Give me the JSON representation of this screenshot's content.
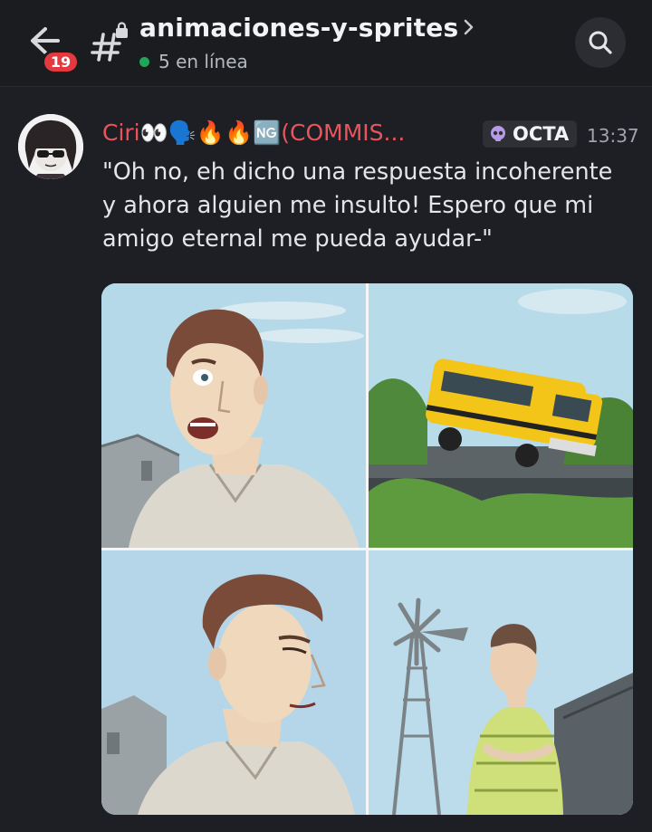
{
  "header": {
    "back_label": "back-arrow",
    "unread_badge": "19",
    "channel_name": "animaciones-y-sprites",
    "online_status": "5 en línea",
    "search_icon": "search-icon",
    "status_color": "#23a559"
  },
  "message": {
    "username": "Ciri👀🗣️🔥🔥🆖(COMMIS...",
    "username_color": "#e8555c",
    "role_tag": "OCTA",
    "role_icon": "skull-icon",
    "timestamp": "13:37",
    "lines": [
      "\"Oh no, eh dicho una respuesta incoherente",
      "y ahora alguien me insulto! Espero que mi",
      "amigo eternal me pueda ayudar-\""
    ],
    "attachment_panels": 4
  }
}
